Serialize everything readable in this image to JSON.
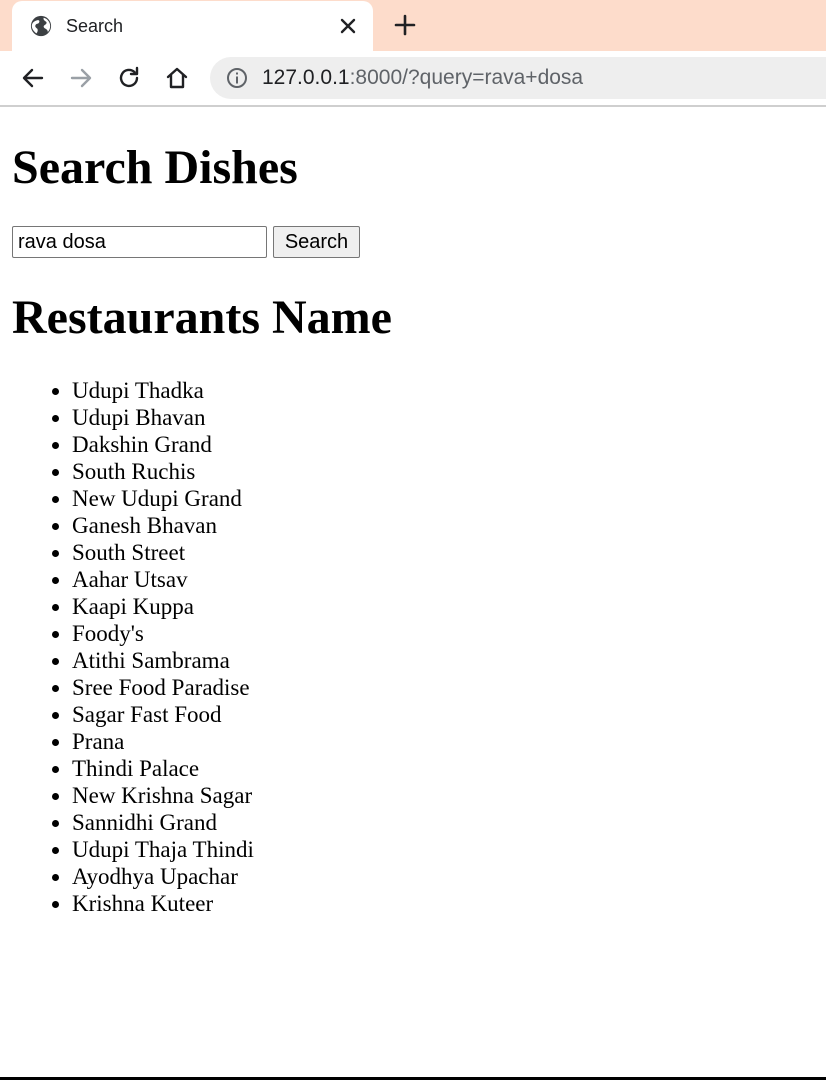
{
  "browser": {
    "tab": {
      "title": "Search",
      "icon": "globe-icon",
      "close_icon": "close-icon"
    },
    "new_tab_icon": "plus-icon",
    "nav": {
      "back_icon": "arrow-left-icon",
      "forward_icon": "arrow-right-icon",
      "reload_icon": "reload-icon",
      "home_icon": "home-icon"
    },
    "address": {
      "icon": "info-icon",
      "host": "127.0.0.1",
      "rest": ":8000/?query=rava+dosa"
    },
    "colors": {
      "tabstrip": "#fddccb",
      "omnibox": "#eeeeee"
    }
  },
  "page": {
    "title": "Search Dishes",
    "search": {
      "value": "rava dosa",
      "button_label": "Search"
    },
    "results_heading": "Restaurants Name",
    "restaurants": [
      "Udupi Thadka",
      "Udupi Bhavan",
      "Dakshin Grand",
      "South Ruchis",
      "New Udupi Grand",
      "Ganesh Bhavan",
      "South Street",
      "Aahar Utsav",
      "Kaapi Kuppa",
      "Foody's",
      "Atithi Sambrama",
      "Sree Food Paradise",
      "Sagar Fast Food",
      "Prana",
      "Thindi Palace",
      "New Krishna Sagar",
      "Sannidhi Grand",
      "Udupi Thaja Thindi",
      "Ayodhya Upachar",
      "Krishna Kuteer"
    ]
  }
}
